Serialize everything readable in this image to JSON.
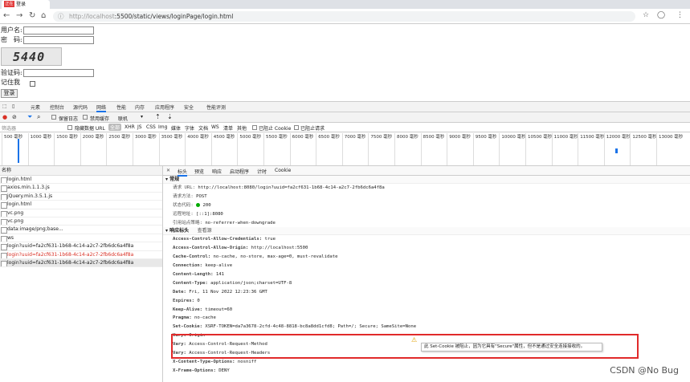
{
  "browser": {
    "tab_label": "登录",
    "tab_badge": "正在测试",
    "url_host": "http://localhost",
    "url_rest": ":5500/static/views/loginPage/login.html"
  },
  "page": {
    "username_label": "用户名:",
    "password_label": "密　码:",
    "captcha_text": "5440",
    "captcha_label": "验证码:",
    "remember_label": "记住我",
    "login_button": "登录"
  },
  "devtools": {
    "tabs": [
      "元素",
      "控制台",
      "源代码",
      "网络",
      "性能",
      "内存",
      "应用程序",
      "安全",
      "性能评测"
    ],
    "active_tab": "网络",
    "toolbar": {
      "preserve_log": "保留日志",
      "disable_cache": "禁用缓存",
      "throttle": "联机"
    },
    "filter": {
      "placeholder": "筛选器",
      "hide_data_url": "隐藏数据 URL",
      "types": [
        "全部",
        "XHR",
        "JS",
        "CSS",
        "Img",
        "媒体",
        "字体",
        "文档",
        "WS",
        "清单",
        "其他"
      ],
      "blocked_cookie": "已阻止 Cookie",
      "blocked_requests": "已阻止请求"
    },
    "timeline_ticks": [
      "500 毫秒",
      "1000 毫秒",
      "1500 毫秒",
      "2000 毫秒",
      "2500 毫秒",
      "3000 毫秒",
      "3500 毫秒",
      "4000 毫秒",
      "4500 毫秒",
      "5000 毫秒",
      "5500 毫秒",
      "6000 毫秒",
      "6500 毫秒",
      "7000 毫秒",
      "7500 毫秒",
      "8000 毫秒",
      "8500 毫秒",
      "9000 毫秒",
      "9500 毫秒",
      "10000 毫秒",
      "10500 毫秒",
      "11000 毫秒",
      "11500 毫秒",
      "12000 毫秒",
      "12500 毫秒",
      "13000 毫秒"
    ],
    "requests_header": "名称",
    "requests": [
      {
        "name": "login.html",
        "state": "normal"
      },
      {
        "name": "axios.min.1.1.3.js",
        "state": "normal"
      },
      {
        "name": "jQuery.min.3.5.1.js",
        "state": "normal"
      },
      {
        "name": "login.html",
        "state": "normal"
      },
      {
        "name": "vc.png",
        "state": "normal"
      },
      {
        "name": "vc.png",
        "state": "normal"
      },
      {
        "name": "data:image/png;base...",
        "state": "normal"
      },
      {
        "name": "ws",
        "state": "normal"
      },
      {
        "name": "login?uuid=fa2cf631-1b68-4c14-a2c7-2fb6dc6a4f8a",
        "state": "normal"
      },
      {
        "name": "login?uuid=fa2cf631-1b68-4c14-a2c7-2fb6dc6a4f8a",
        "state": "err"
      },
      {
        "name": "login?uuid=fa2cf631-1b68-4c14-a2c7-2fb6dc6a4f8a",
        "state": "sel"
      }
    ],
    "detail_tabs": [
      "标头",
      "预览",
      "响应",
      "启动程序",
      "计时",
      "Cookie"
    ],
    "general_title": "常规",
    "general": [
      {
        "k": "请求 URL:",
        "v": "http://localhost:8080/login?uuid=fa2cf631-1b68-4c14-a2c7-2fb6dc6a4f8a"
      },
      {
        "k": "请求方法:",
        "v": "POST"
      },
      {
        "k": "状态代码:",
        "v": "200"
      },
      {
        "k": "远程地址:",
        "v": "[::1]:8080"
      },
      {
        "k": "引用站点策略:",
        "v": "no-referrer-when-downgrade"
      }
    ],
    "response_title": "响应标头",
    "response_view_source": "查看源",
    "response_headers": [
      {
        "k": "Access-Control-Allow-Credentials:",
        "v": "true"
      },
      {
        "k": "Access-Control-Allow-Origin:",
        "v": "http://localhost:5500"
      },
      {
        "k": "Cache-Control:",
        "v": "no-cache, no-store, max-age=0, must-revalidate"
      },
      {
        "k": "Connection:",
        "v": "keep-alive"
      },
      {
        "k": "Content-Length:",
        "v": "141"
      },
      {
        "k": "Content-Type:",
        "v": "application/json;charset=UTF-8"
      },
      {
        "k": "Date:",
        "v": "Fri, 11 Nov 2022 12:23:36 GMT"
      },
      {
        "k": "Expires:",
        "v": "0"
      },
      {
        "k": "Keep-Alive:",
        "v": "timeout=60"
      },
      {
        "k": "Pragma:",
        "v": "no-cache"
      },
      {
        "k": "Set-Cookie:",
        "v": "XSRF-TOKEN=da7a3678-2cfd-4c48-8818-bc8a8dd1cfd8; Path=/; Secure; SameSite=None"
      },
      {
        "k": "Vary:",
        "v": "Origin"
      },
      {
        "k": "Vary:",
        "v": "Access-Control-Request-Method"
      },
      {
        "k": "Vary:",
        "v": "Access-Control-Request-Headers"
      },
      {
        "k": "X-Content-Type-Options:",
        "v": "nosniff"
      },
      {
        "k": "X-Frame-Options:",
        "v": "DENY"
      }
    ],
    "tooltip": "此 Set-Cookie 被阻止，因为它具有\"Secure\"属性，但不是通过安全连接接收的。"
  },
  "watermark": "CSDN @No  Bug"
}
